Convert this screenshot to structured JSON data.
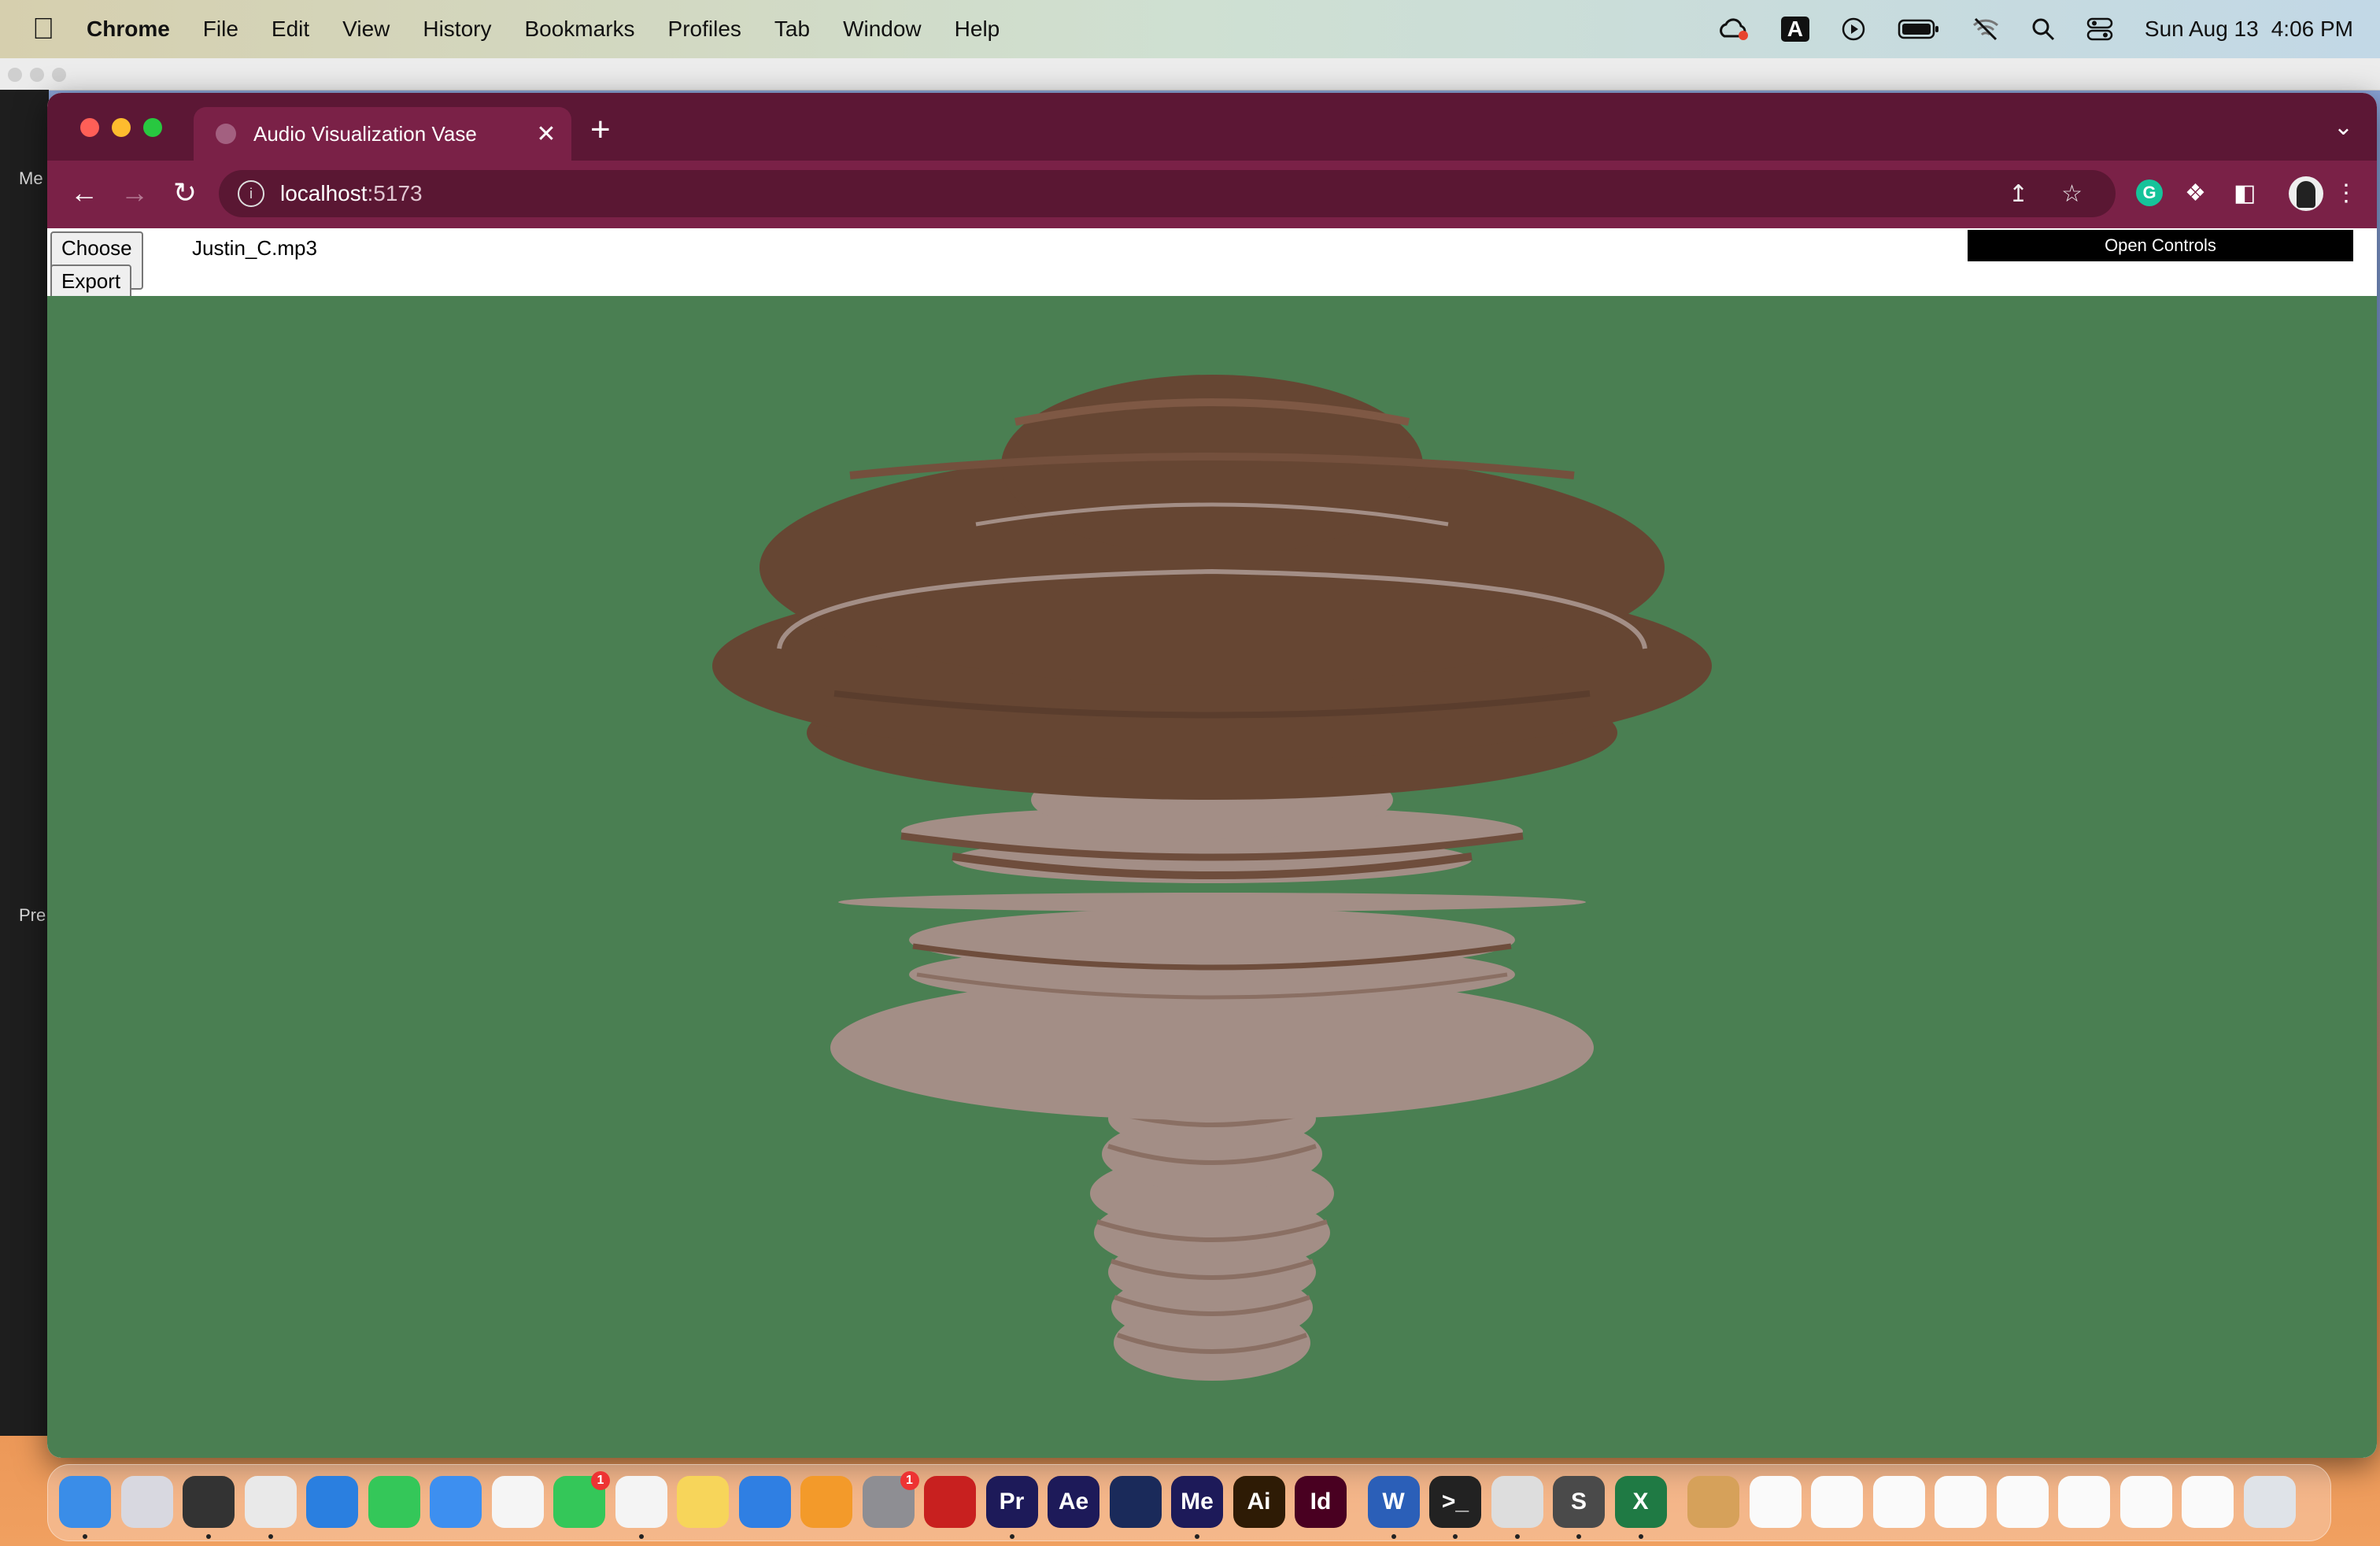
{
  "menubar": {
    "app_name": "Chrome",
    "items": [
      "File",
      "Edit",
      "View",
      "History",
      "Bookmarks",
      "Profiles",
      "Tab",
      "Window",
      "Help"
    ],
    "date": "Sun Aug 13",
    "time": "4:06 PM",
    "input_indicator": "A"
  },
  "background_window": {
    "labels": [
      "Me",
      "Pre"
    ]
  },
  "browser": {
    "tab_title": "Audio Visualization Vase",
    "url_host": "localhost",
    "url_port": ":5173"
  },
  "page": {
    "choose_file_label": "Choose File",
    "file_name": "Justin_C.mp3",
    "export_label": "Export STL",
    "open_controls_label": "Open Controls",
    "background_color": "#4a7f52",
    "vase_colors": {
      "top": "#664633",
      "bottom": "#a38e86"
    }
  },
  "dock": {
    "apps": [
      {
        "name": "Finder",
        "text": "",
        "color": "#3a8de8"
      },
      {
        "name": "Launchpad",
        "text": "",
        "color": "#d8d8e0"
      },
      {
        "name": "QuickTime",
        "text": "",
        "color": "#333"
      },
      {
        "name": "Chrome",
        "text": "",
        "color": "#e9e9e9"
      },
      {
        "name": "Safari",
        "text": "",
        "color": "#2a7fe0"
      },
      {
        "name": "Messages",
        "text": "",
        "color": "#34c759"
      },
      {
        "name": "Mail",
        "text": "",
        "color": "#3d8ff0"
      },
      {
        "name": "Photos",
        "text": "",
        "color": "#f5f5f5"
      },
      {
        "name": "FaceTime",
        "text": "",
        "color": "#34c759",
        "badge": "1"
      },
      {
        "name": "TextEdit",
        "text": "",
        "color": "#f4f4f4"
      },
      {
        "name": "Notes",
        "text": "",
        "color": "#f7d55a"
      },
      {
        "name": "Keynote",
        "text": "",
        "color": "#2f7fe3"
      },
      {
        "name": "Pages",
        "text": "",
        "color": "#f39a2a"
      },
      {
        "name": "System Settings",
        "text": "",
        "color": "#8e8e93",
        "badge": "1"
      },
      {
        "name": "Acrobat",
        "text": "",
        "color": "#c8201f"
      },
      {
        "name": "Premiere Pro",
        "text": "Pr",
        "color": "#1d1a59"
      },
      {
        "name": "After Effects",
        "text": "Ae",
        "color": "#1d1a59"
      },
      {
        "name": "Cinema 4D",
        "text": "",
        "color": "#1a2a5a"
      },
      {
        "name": "Media Encoder",
        "text": "Me",
        "color": "#1d1a59"
      },
      {
        "name": "Illustrator",
        "text": "Ai",
        "color": "#2e1b05"
      },
      {
        "name": "InDesign",
        "text": "Id",
        "color": "#490021"
      },
      {
        "name": "Word",
        "text": "W",
        "color": "#2b5fb8"
      },
      {
        "name": "Terminal",
        "text": ">_",
        "color": "#222"
      },
      {
        "name": "Rocket",
        "text": "",
        "color": "#ddd"
      },
      {
        "name": "Sublime Text",
        "text": "S",
        "color": "#4a4a4a"
      },
      {
        "name": "Excel",
        "text": "X",
        "color": "#1f7a44"
      },
      {
        "name": "Archive",
        "text": "",
        "color": "#d6a15a"
      },
      {
        "name": "Doc 1",
        "text": "",
        "color": "#fafafa"
      },
      {
        "name": "Doc 2",
        "text": "",
        "color": "#fafafa"
      },
      {
        "name": "Doc 3",
        "text": "",
        "color": "#fafafa"
      },
      {
        "name": "Doc 4",
        "text": "",
        "color": "#fafafa"
      },
      {
        "name": "Doc 5",
        "text": "",
        "color": "#fafafa"
      },
      {
        "name": "Doc 6",
        "text": "",
        "color": "#fafafa"
      },
      {
        "name": "Doc 7",
        "text": "",
        "color": "#fafafa"
      },
      {
        "name": "Doc 8",
        "text": "",
        "color": "#fafafa"
      },
      {
        "name": "Trash",
        "text": "",
        "color": "#dfe3e8"
      }
    ]
  }
}
